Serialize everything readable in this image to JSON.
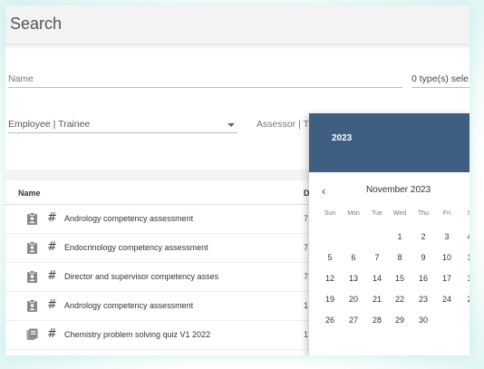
{
  "header": {
    "title": "Search"
  },
  "filters": {
    "name_label": "Name",
    "types_value": "0 type(s) sele",
    "employee_value": "Employee | Trainee",
    "assessor_label": "Assessor | T"
  },
  "table": {
    "columns": [
      "Name",
      "D"
    ],
    "rows": [
      {
        "icon": "assessment-icon",
        "name": "Andrology competency assessment",
        "date": "7."
      },
      {
        "icon": "assessment-icon",
        "name": "Endocrinology competency assessment",
        "date": "7."
      },
      {
        "icon": "assessment-icon",
        "name": "Director and supervisor competency asses",
        "date": "7."
      },
      {
        "icon": "assessment-icon",
        "name": "Andrology competency assessment",
        "date": "1"
      },
      {
        "icon": "quiz-icon",
        "name": "Chemistry problem solving quiz V1 2022",
        "date": "1"
      }
    ]
  },
  "datepicker": {
    "year": "2023",
    "month": "November 2023",
    "prev": "‹",
    "weekdays": [
      "Sun",
      "Mon",
      "Tue",
      "Wed",
      "Thu",
      "Fri",
      "S"
    ],
    "weeks": [
      [
        "",
        "",
        "",
        "1",
        "2",
        "3",
        "4"
      ],
      [
        "5",
        "6",
        "7",
        "8",
        "9",
        "10",
        "1"
      ],
      [
        "12",
        "13",
        "14",
        "15",
        "16",
        "17",
        "1"
      ],
      [
        "19",
        "20",
        "21",
        "22",
        "23",
        "24",
        "2"
      ],
      [
        "26",
        "27",
        "28",
        "29",
        "30",
        "",
        ""
      ]
    ],
    "header_color": "#3f5f82"
  }
}
